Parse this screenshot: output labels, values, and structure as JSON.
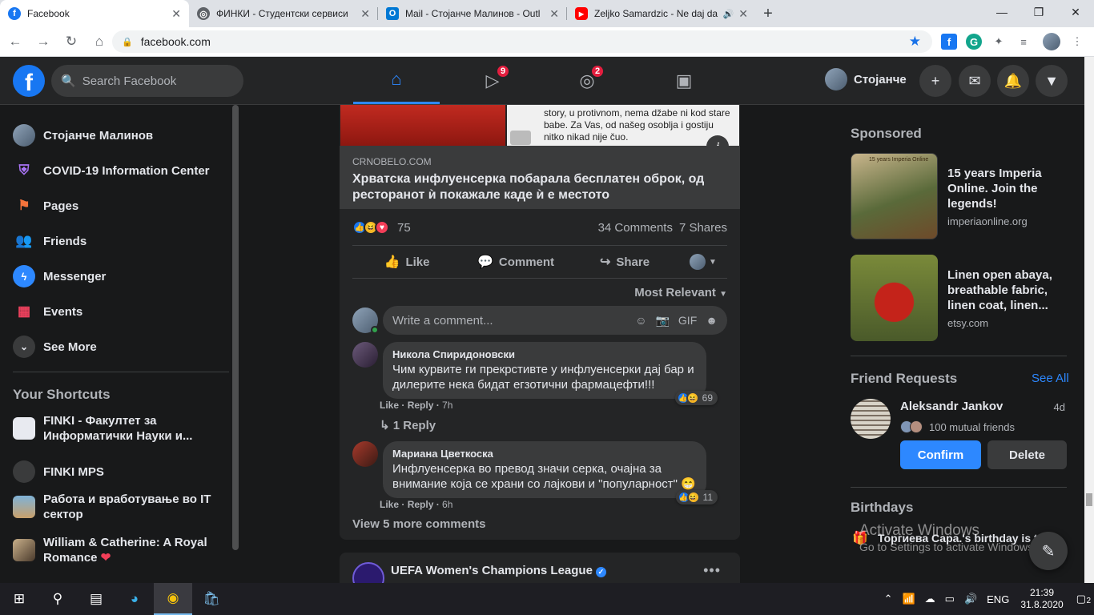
{
  "browser": {
    "tabs": [
      {
        "title": "Facebook",
        "active": true,
        "favicon": "facebook-icon",
        "color": "#1877f2"
      },
      {
        "title": "ФИНКИ - Студентски сервиси",
        "active": false,
        "favicon": "globe-icon",
        "color": "#5f6368"
      },
      {
        "title": "Mail - Стојанче Малинов - Outl",
        "active": false,
        "favicon": "outlook-icon",
        "color": "#0078d4"
      },
      {
        "title": "Zeljko Samardzic - Ne daj da",
        "active": false,
        "favicon": "youtube-icon",
        "color": "#ff0000"
      }
    ],
    "url": "facebook.com"
  },
  "header": {
    "search_placeholder": "Search Facebook",
    "watch_badge": "9",
    "groups_badge": "2",
    "profile_name": "Стојанче"
  },
  "sidebar": {
    "items": [
      {
        "label": "Стојанче Малинов",
        "icon": "avatar"
      },
      {
        "label": "COVID-19 Information Center",
        "icon": "covid-shield-icon"
      },
      {
        "label": "Pages",
        "icon": "flag-icon"
      },
      {
        "label": "Friends",
        "icon": "friends-icon"
      },
      {
        "label": "Messenger",
        "icon": "messenger-icon"
      },
      {
        "label": "Events",
        "icon": "calendar-icon"
      },
      {
        "label": "See More",
        "icon": "chevron-down-icon"
      }
    ],
    "shortcuts_title": "Your Shortcuts",
    "shortcuts": [
      {
        "label": "FINKI - Факултет за Информатички Науки и..."
      },
      {
        "label": "FINKI MPS"
      },
      {
        "label": "Работа и вработување во IT сектор"
      },
      {
        "label": "William & Catherine: A Royal Romance"
      }
    ]
  },
  "post": {
    "image_text": "story, u protivnom, nema džabe ni kod stare babe. Za Vas, od našeg osoblja i gostiju nitko nikad nije čuo.",
    "link_domain": "CRNOBELO.COM",
    "link_title": "Хрватска инфлуенсерка побарала бесплатен оброк, од ресторанот ѝ покажале каде ѝ е местото",
    "reactions_count": "75",
    "comments_count": "34 Comments",
    "shares_count": "7 Shares",
    "like_label": "Like",
    "comment_label": "Comment",
    "share_label": "Share",
    "sort_label": "Most Relevant",
    "write_placeholder": "Write a comment...",
    "comments": [
      {
        "name": "Никола Спиридоновски",
        "text": "Чим курвите ги прекрстивте у инфлуенсерки дај бар и дилерите нека бидат егзотични фармацефти!!!",
        "like": "Like",
        "reply": "Reply",
        "time": "7h",
        "reactions": "69",
        "replies": "1 Reply"
      },
      {
        "name": "Мариана Цветкоска",
        "text": "Инфлуенсерка во превод значи серка, очајна за внимание која се храни со лајкови и \"популарност\" 😁",
        "like": "Like",
        "reply": "Reply",
        "time": "6h",
        "reactions": "11"
      }
    ],
    "view_more": "View 5 more comments"
  },
  "next_post": {
    "page_name": "UEFA Women's Champions League"
  },
  "right": {
    "sponsored_title": "Sponsored",
    "ads": [
      {
        "title": "15 years Imperia Online. Join the legends!",
        "domain": "imperiaonline.org",
        "image_text": "15 years Imperia Online"
      },
      {
        "title": "Linen open abaya, breathable fabric, linen coat, linen...",
        "domain": "etsy.com"
      }
    ],
    "friend_requests_title": "Friend Requests",
    "see_all": "See All",
    "request": {
      "name": "Aleksandr Jankov",
      "time": "4d",
      "mutual": "100 mutual friends",
      "confirm": "Confirm",
      "delete": "Delete"
    },
    "birthdays_title": "Birthdays",
    "birthday_text": "Торгиева Сара.'s birthday is to",
    "activate_line1": "Activate Windows",
    "activate_line2": "Go to Settings to activate Windows."
  },
  "taskbar": {
    "language": "ENG",
    "time": "21:39",
    "date": "31.8.2020",
    "notification_count": "2"
  },
  "colors": {
    "fb_blue": "#1877f2",
    "accent_blue": "#2d88ff",
    "badge_red": "#e41e3f",
    "surface": "#242526",
    "background": "#18191a"
  }
}
